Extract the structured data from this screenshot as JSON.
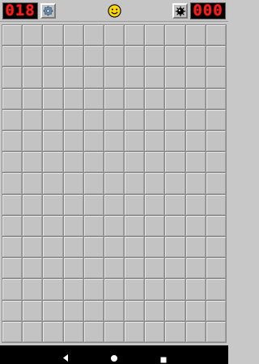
{
  "header": {
    "flag_counter": "018",
    "timer": "000",
    "settings_icon": "gear-icon",
    "face_icon": "smiley-face-icon",
    "mine_icon": "mine-icon"
  },
  "board": {
    "columns": 11,
    "rows": 15,
    "cell_state": "unrevealed"
  },
  "navbar": {
    "back_icon": "back-icon",
    "home_icon": "home-icon",
    "recents_icon": "recents-icon"
  },
  "colors": {
    "lcd_digit": "#ff1a1a",
    "lcd_background": "#000000",
    "cell": "#c3c3c3",
    "smiley": "#ffd700"
  }
}
